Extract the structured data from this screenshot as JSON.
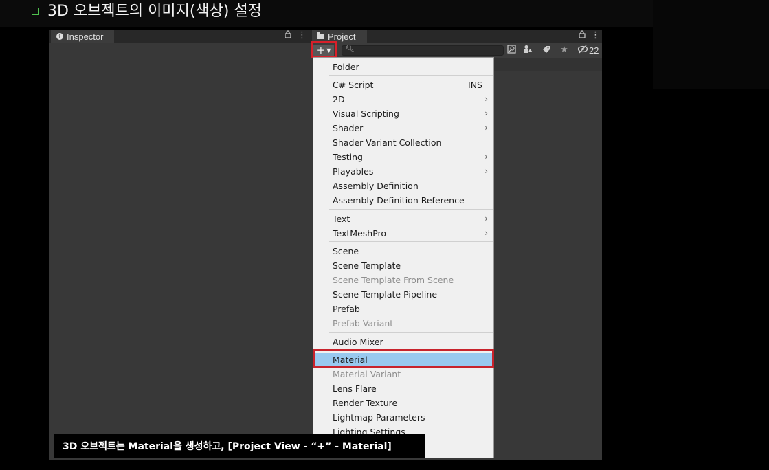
{
  "slide": {
    "title": "3D 오브젝트의 이미지(색상) 설정",
    "caption": "3D 오브젝트는 Material을 생성하고, [Project View - “+” - Material]"
  },
  "inspector": {
    "tab_label": "Inspector",
    "info_icon": "i",
    "lock_icon": "lock-icon",
    "more_icon": "kebab-menu-icon"
  },
  "project": {
    "tab_label": "Project",
    "create_button": "+",
    "search": {
      "value": "",
      "placeholder": ""
    },
    "hidden_count": "22",
    "icons": [
      "search-icon",
      "search-by-type-icon",
      "label-icon",
      "favorite-icon",
      "hidden-packages-icon"
    ]
  },
  "create_menu": {
    "items": [
      {
        "label": "Folder"
      },
      {
        "label": "C# Script",
        "shortcut": "INS"
      },
      {
        "label": "2D",
        "submenu": true
      },
      {
        "label": "Visual Scripting",
        "submenu": true
      },
      {
        "label": "Shader",
        "submenu": true
      },
      {
        "label": "Shader Variant Collection"
      },
      {
        "label": "Testing",
        "submenu": true
      },
      {
        "label": "Playables",
        "submenu": true
      },
      {
        "label": "Assembly Definition"
      },
      {
        "label": "Assembly Definition Reference"
      },
      {
        "label": "Text",
        "submenu": true
      },
      {
        "label": "TextMeshPro",
        "submenu": true
      },
      {
        "label": "Scene"
      },
      {
        "label": "Scene Template"
      },
      {
        "label": "Scene Template From Scene",
        "disabled": true
      },
      {
        "label": "Scene Template Pipeline"
      },
      {
        "label": "Prefab"
      },
      {
        "label": "Prefab Variant",
        "disabled": true
      },
      {
        "label": "Audio Mixer"
      },
      {
        "label": "Material",
        "selected": true
      },
      {
        "label": "Material Variant",
        "disabled": true
      },
      {
        "label": "Lens Flare"
      },
      {
        "label": "Render Texture"
      },
      {
        "label": "Lightmap Parameters"
      },
      {
        "label": "Lighting Settings"
      }
    ],
    "submenu_arrow": "›"
  },
  "colors": {
    "highlight_border": "#d8202a",
    "selected_item": "#99c9ef",
    "title_bullet": "#4fc24f"
  }
}
